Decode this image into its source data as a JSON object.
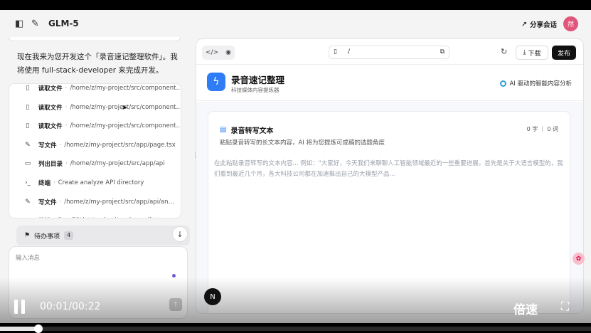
{
  "topbar": {
    "title": "GLM-5",
    "share_label": "分享会话",
    "avatar_text": "然"
  },
  "chat": {
    "intro": "现在我来为您开发这个「录音速记整理软件」。我将使用 full-stack-developer 来完成开发。",
    "tools": [
      {
        "icon": "file-icon",
        "name": "读取文件",
        "path": "/home/z/my-project/src/components..."
      },
      {
        "icon": "file-icon",
        "name": "读取文件",
        "path": "/home/z/my-project/src/components..."
      },
      {
        "icon": "file-icon",
        "name": "读取文件",
        "path": "/home/z/my-project/src/components..."
      },
      {
        "icon": "pen-icon",
        "name": "写文件",
        "path": "/home/z/my-project/src/app/page.tsx"
      },
      {
        "icon": "folder-icon",
        "name": "列出目录",
        "path": "/home/z/my-project/src/app/api"
      },
      {
        "icon": "terminal-icon",
        "name": "终端",
        "path": "Create analyze API directory"
      },
      {
        "icon": "pen-icon",
        "name": "写文件",
        "path": "/home/z/my-project/src/app/api/analyz..."
      },
      {
        "icon": "terminal-icon",
        "name": "终端",
        "path": "Run ESLint to check code quality"
      }
    ],
    "todo_label": "待办事项",
    "todo_count": "4",
    "input_placeholder": "输入消息"
  },
  "preview": {
    "url_path": "/",
    "download_label": "下载",
    "publish_label": "发布",
    "app_title": "录音速记整理",
    "app_subtitle": "科技媒体内容提炼器",
    "ai_tag": "AI 驱动的智能内容分析",
    "card_title": "录音转写文本",
    "card_count": "0 字 ｜ 0 词",
    "card_desc": "粘贴录音转写的长文本内容，AI 将为您提炼可成稿的选题角度",
    "textarea_placeholder": "在此粘贴录音转写的文本内容... 例如：\"大家好，今天我们来聊聊人工智能领域最近的一些重要进展。首先是关于大语言模型的，我们看到最近几个月，各大科技公司都在加速推出自己的大模型产品..."
  },
  "video": {
    "time": "00:01/00:22",
    "speed_label": "倍速",
    "progress": 0.065,
    "n_badge": "N"
  },
  "colors": {
    "accent": "#2f7df6",
    "avatar": "#e0567a",
    "publish": "#111111"
  }
}
